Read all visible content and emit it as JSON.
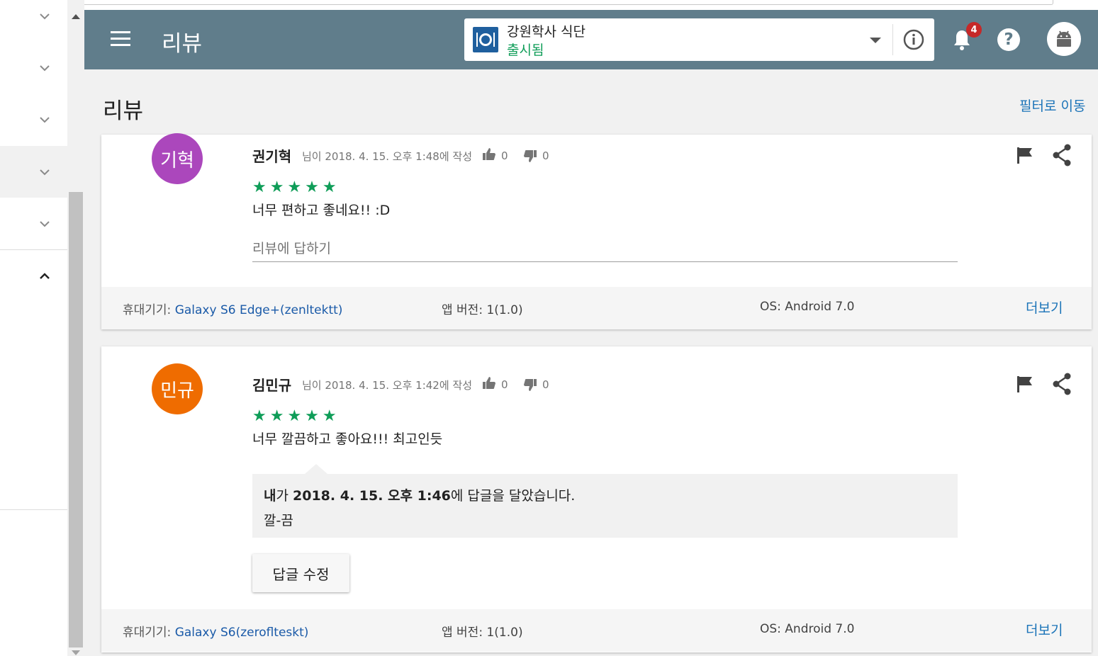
{
  "header": {
    "title": "리뷰",
    "app": {
      "name": "강원학사 식단",
      "status": "출시됨"
    },
    "notification_count": "4",
    "help_label": "?"
  },
  "page": {
    "title": "리뷰",
    "filter_link": "필터로 이동"
  },
  "reviews": [
    {
      "avatar_text": "기혁",
      "avatar_color": "#ab47bc",
      "author": "권기혁",
      "meta": "님이 2018. 4. 15. 오후 1:48에 작성",
      "likes": "0",
      "dislikes": "0",
      "stars": "★★★★★",
      "text": "너무 편하고 좋네요!! :D",
      "reply_placeholder": "리뷰에 답하기",
      "device_label": "휴대기기: ",
      "device": "Galaxy S6 Edge+(zenltektt)",
      "version": "앱 버전: 1(1.0)",
      "os": "OS: Android 7.0",
      "more": "더보기"
    },
    {
      "avatar_text": "민규",
      "avatar_color": "#ef6c00",
      "author": "김민규",
      "meta": "님이 2018. 4. 15. 오후 1:42에 작성",
      "likes": "0",
      "dislikes": "0",
      "stars": "★★★★★",
      "text": "너무 깔끔하고 좋아요!!! 최고인듯",
      "dev_reply": {
        "who": "내",
        "who_suffix": "가 ",
        "date": "2018. 4. 15. 오후 1:46",
        "suffix": "에 답글을 달았습니다.",
        "text": "깔-끔"
      },
      "edit_button": "답글 수정",
      "device_label": "휴대기기: ",
      "device": "Galaxy S6(zeroflteskt)",
      "version": "앱 버전: 1(1.0)",
      "os": "OS: Android 7.0",
      "more": "더보기"
    }
  ]
}
